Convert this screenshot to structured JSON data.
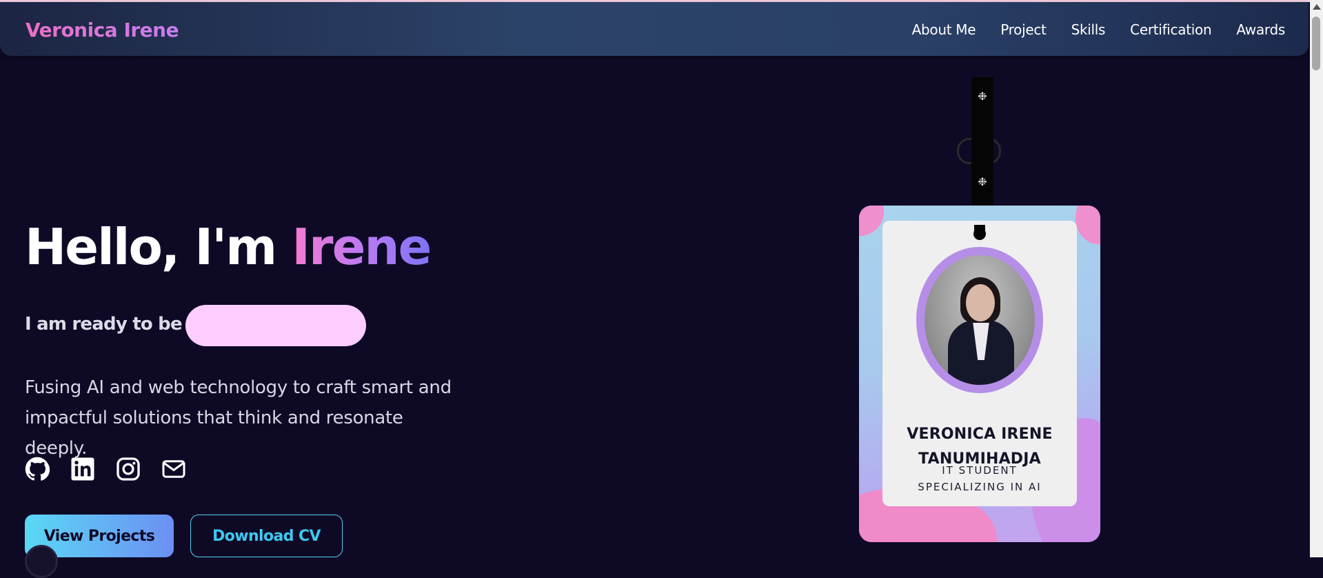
{
  "nav": {
    "brand": "Veronica Irene",
    "links": [
      "About Me",
      "Project",
      "Skills",
      "Certification",
      "Awards"
    ]
  },
  "hero": {
    "greeting": "Hello, I'm ",
    "name": "Irene",
    "ready_text": "I am ready to be a",
    "tagline": "Fusing AI and web technology to craft smart and impactful solutions that think and resonate deeply.",
    "socials": [
      "github-icon",
      "linkedin-icon",
      "instagram-icon",
      "mail-icon"
    ],
    "buttons": {
      "primary": "View Projects",
      "secondary": "Download CV"
    }
  },
  "badge": {
    "name_line1": "VERONICA IRENE",
    "name_line2": "TANUMIHADJA",
    "role_line1": "IT STUDENT",
    "role_line2": "SPECIALIZING IN AI"
  },
  "colors": {
    "background": "#0e0a26",
    "accent_pink": "#f47ad2",
    "accent_purple": "#7d74f6",
    "accent_cyan": "#3fc8ee",
    "pill": "#fdcdff"
  }
}
